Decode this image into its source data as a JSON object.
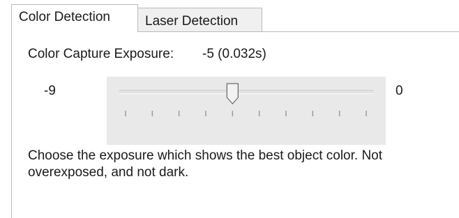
{
  "tabs": [
    {
      "label": "Color Detection",
      "selected": true
    },
    {
      "label": "Laser Detection",
      "selected": false
    }
  ],
  "exposure": {
    "label": "Color Capture Exposure:",
    "value_text": "-5 (0.032s)",
    "min_label": "-9",
    "max_label": "0",
    "min": -9,
    "max": 0,
    "value": -5
  },
  "description": "Choose the exposure which shows the best object color. Not overexposed, and not dark.",
  "colors": {
    "tab_selected_bg": "#ffffff",
    "tab_unselected_bg": "#f0f0f0",
    "slider_bg": "#e9e9e9",
    "border": "#b9b9b9"
  }
}
